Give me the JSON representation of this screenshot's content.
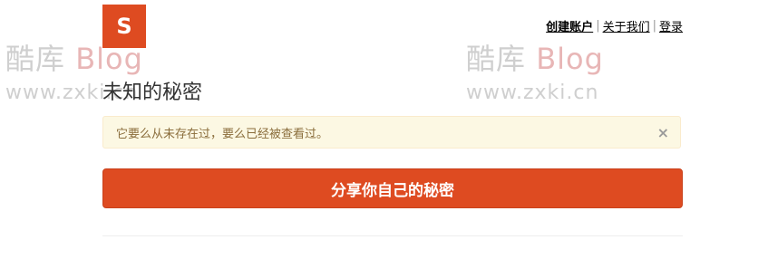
{
  "logo": {
    "letter": "S"
  },
  "nav": {
    "create_account": "创建账户",
    "separator": "|",
    "about_us": "关于我们",
    "login": "登录"
  },
  "watermark": {
    "brand": "酷库",
    "blog": "Blog",
    "url": "www.zxki.cn"
  },
  "page": {
    "title": "未知的秘密"
  },
  "alert": {
    "message": "它要么从未存在过，要么已经被查看过。",
    "close": "×"
  },
  "share_button": {
    "label": "分享你自己的秘密"
  },
  "colors": {
    "brand": "#de4b21",
    "alert_bg": "#fcf8e3",
    "alert_text": "#8a6d3b"
  }
}
